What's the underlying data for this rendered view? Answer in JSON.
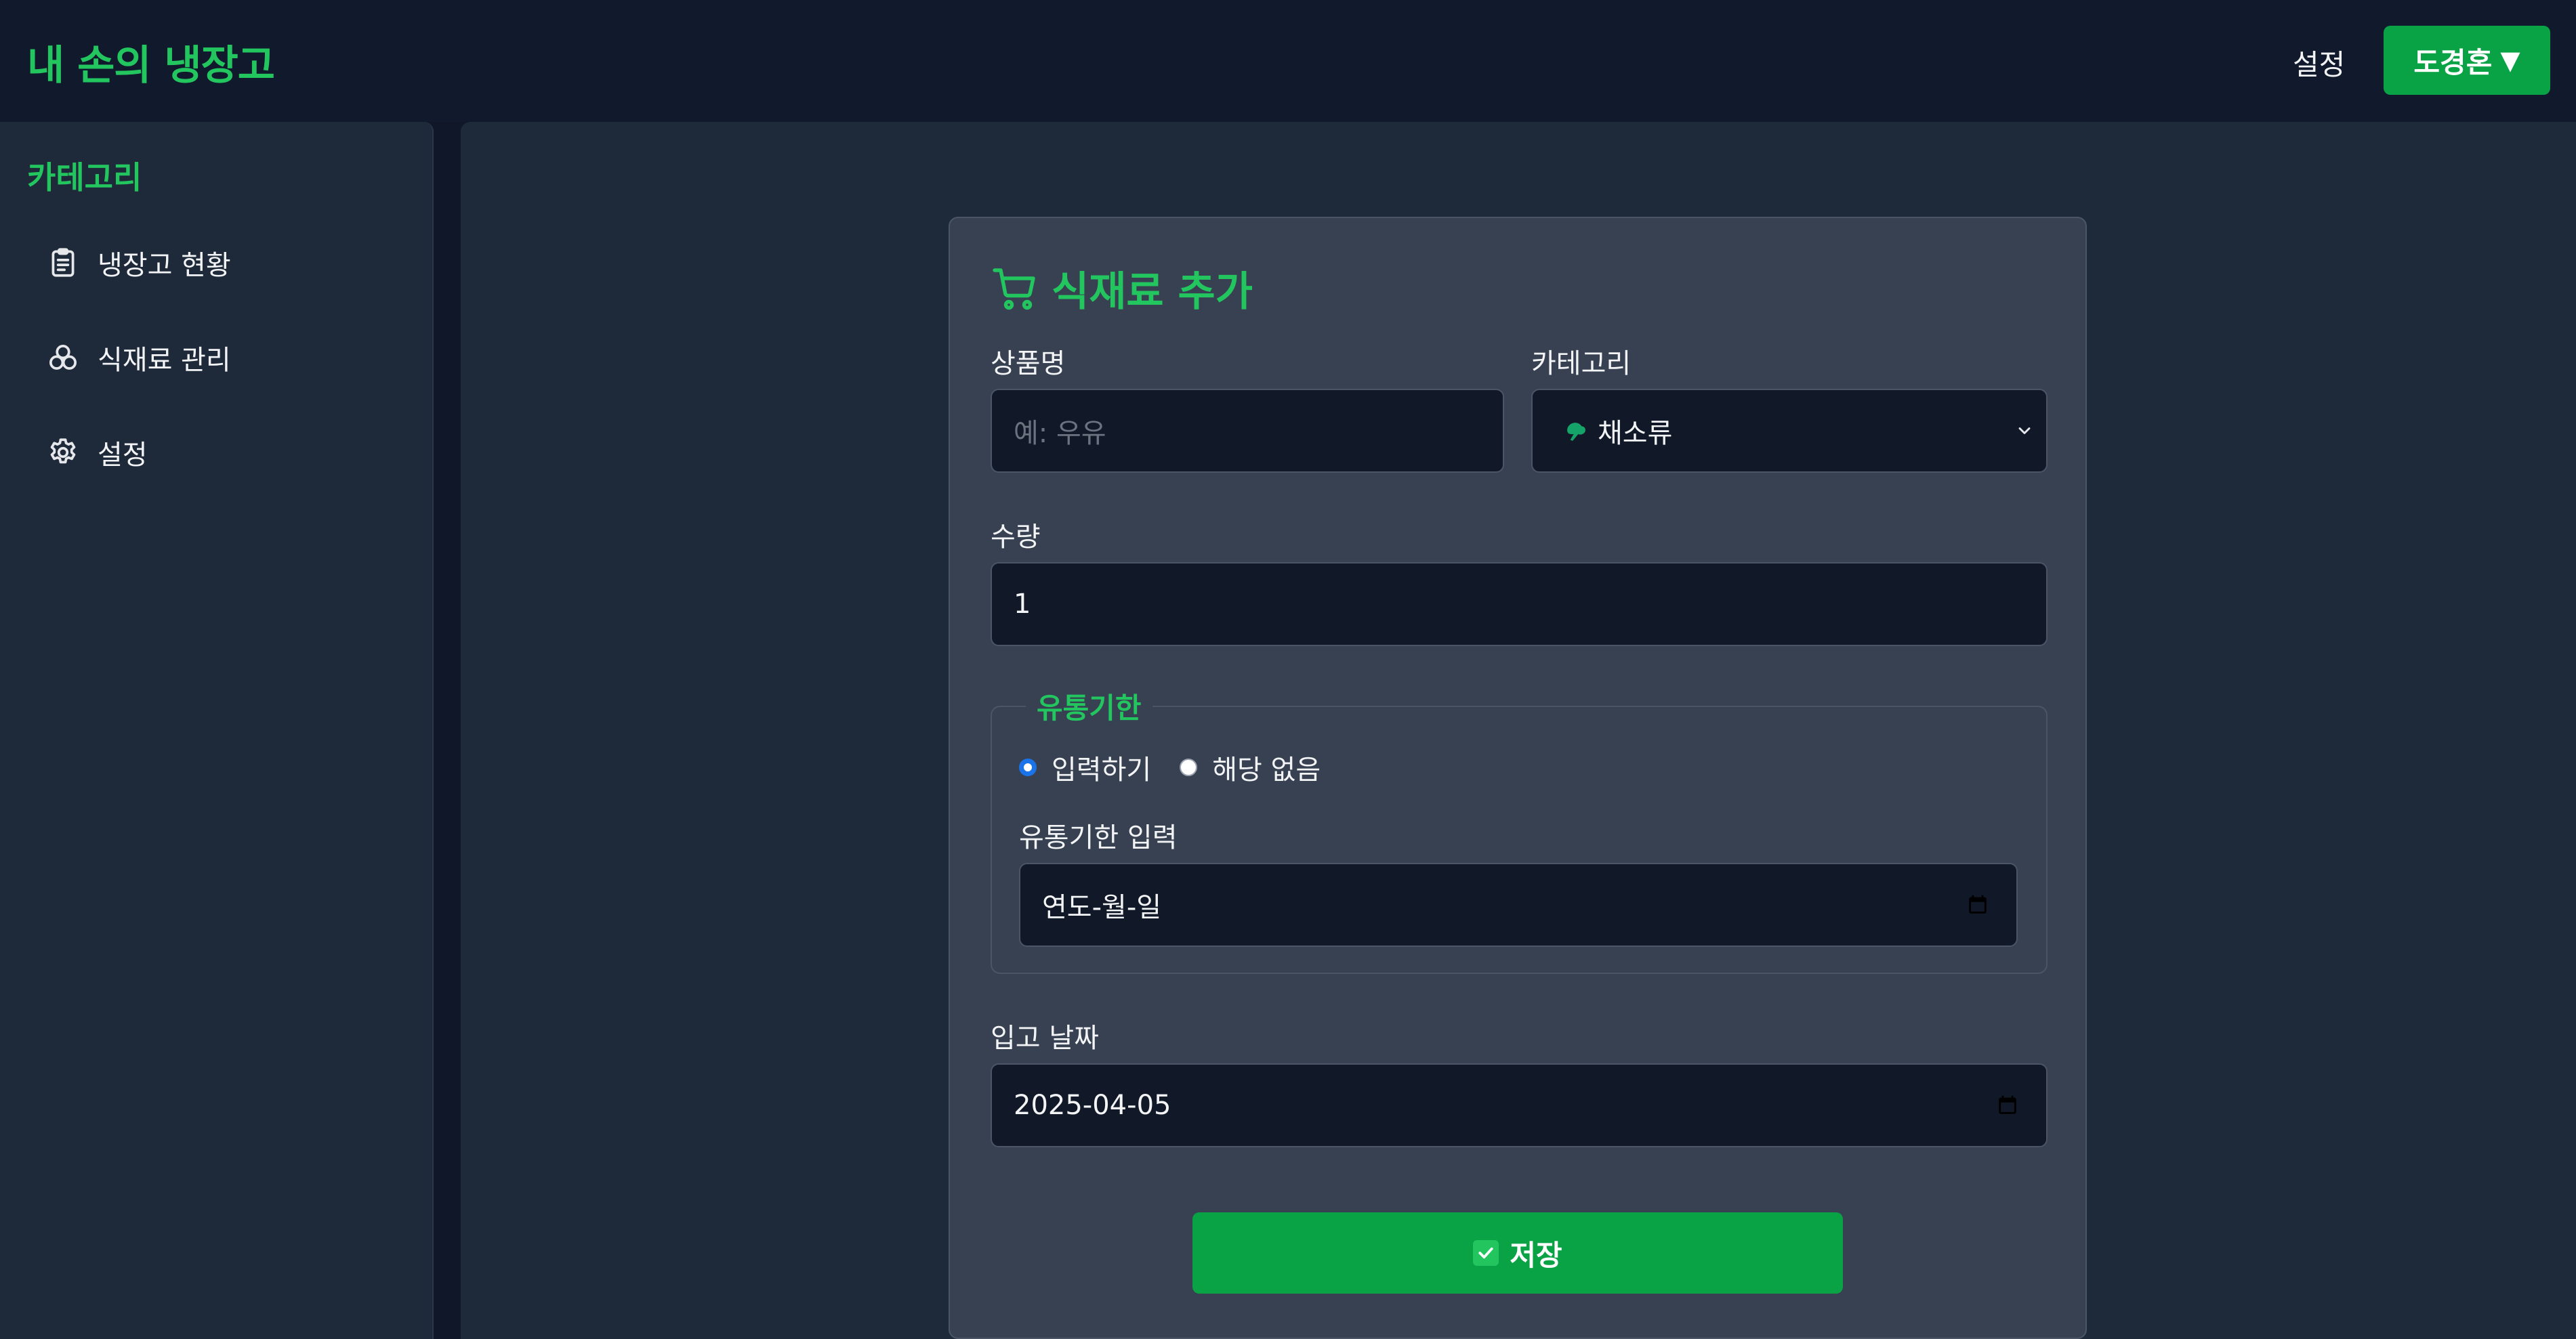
{
  "header": {
    "app_title": "내 손의 냉장고",
    "settings_label": "설정",
    "user_name": "도경혼",
    "user_caret": "▼"
  },
  "sidebar": {
    "title": "카테고리",
    "items": [
      {
        "label": "냉장고 현황",
        "icon": "clipboard-icon"
      },
      {
        "label": "식재료 관리",
        "icon": "ingredients-icon"
      },
      {
        "label": "설정",
        "icon": "gear-icon"
      }
    ]
  },
  "form": {
    "title": "식재료 추가",
    "title_icon": "cart-icon",
    "product_name": {
      "label": "상품명",
      "placeholder": "예: 우유",
      "value": ""
    },
    "category": {
      "label": "카테고리",
      "selected": "채소류",
      "selected_icon": "vegetable-icon"
    },
    "quantity": {
      "label": "수량",
      "value": "1"
    },
    "expiry": {
      "legend": "유통기한",
      "options": [
        {
          "label": "입력하기",
          "checked": true
        },
        {
          "label": "해당 없음",
          "checked": false
        }
      ],
      "input_label": "유통기한 입력",
      "input_value": "연도-월-일"
    },
    "received_date": {
      "label": "입고 날짜",
      "value": "2025-04-05"
    },
    "save_label": "저장"
  },
  "colors": {
    "accent": "#22c55e",
    "button": "#09a345",
    "radio_selected": "#1a73e8",
    "background": "#0f1729",
    "panel": "#1e293a",
    "card": "#374152",
    "input": "#111827"
  }
}
